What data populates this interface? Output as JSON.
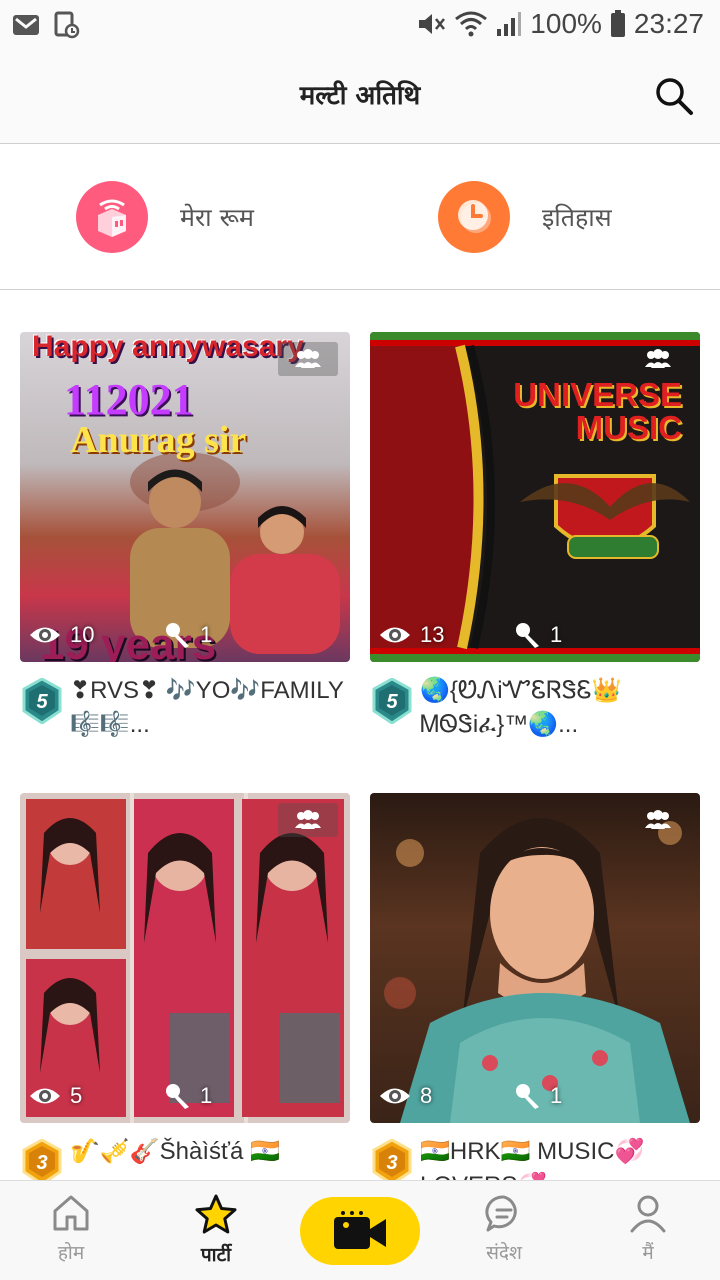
{
  "status_bar": {
    "battery": "100%",
    "time": "23:27"
  },
  "header": {
    "title": "मल्टी अतिथि"
  },
  "quick_actions": {
    "my_room": "मेरा रूम",
    "history": "इतिहास"
  },
  "rooms": [
    {
      "viewers": "10",
      "guests": "1",
      "level": "5",
      "title": "❣RVS❣ 🎶YO🎶FAMILY 🎼🎼...",
      "art_text": [
        "Happy annywasary",
        "112021",
        "Anurag sir",
        "19 years"
      ]
    },
    {
      "viewers": "13",
      "guests": "1",
      "level": "5",
      "title": "🌏{ᏬᏁiᏉᏋᏒᏕᏋ👑 ᎷᏫᏕiፈ}™🌏...",
      "art_text": [
        "UNIVERSE",
        "MUSIC"
      ]
    },
    {
      "viewers": "5",
      "guests": "1",
      "level": "3",
      "title": "🎷🎺🎸Šhàìśťá 🇮🇳",
      "art_text": []
    },
    {
      "viewers": "8",
      "guests": "1",
      "level": "3",
      "title": "🇮🇳HRK🇮🇳 MUSIC💞LOVERS💞",
      "art_text": []
    }
  ],
  "bottom_nav": {
    "home": "होम",
    "party": "पार्टी",
    "messages": "संदेश",
    "me": "मैं"
  },
  "colors": {
    "accent": "#ffd400",
    "my_room_icon": "#ff5b7f",
    "history_icon": "#ff7a35",
    "level_badge": "#2a8a8a",
    "level_badge_gold": "#f2a20c"
  }
}
